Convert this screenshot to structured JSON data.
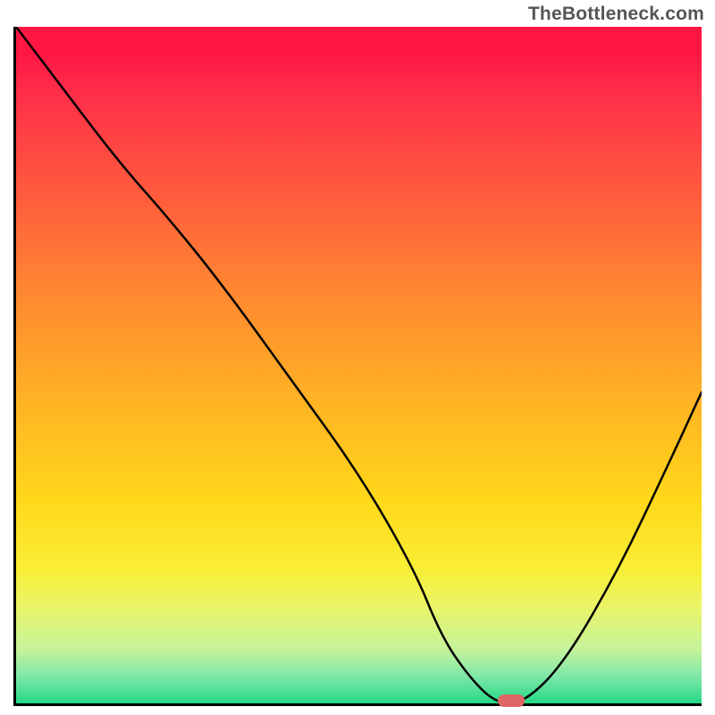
{
  "watermark": "TheBottleneck.com",
  "chart_data": {
    "type": "line",
    "title": "",
    "xlabel": "",
    "ylabel": "",
    "xlim": [
      0,
      100
    ],
    "ylim": [
      0,
      100
    ],
    "grid": false,
    "legend": false,
    "series": [
      {
        "name": "bottleneck-curve",
        "x": [
          0,
          6,
          15,
          22,
          30,
          40,
          50,
          58,
          62,
          66,
          70,
          74,
          80,
          88,
          95,
          100
        ],
        "values": [
          100,
          92,
          80,
          72,
          62,
          48,
          34,
          20,
          10,
          4,
          0,
          0,
          6,
          20,
          35,
          46
        ]
      }
    ],
    "marker": {
      "x": 72,
      "y": 0,
      "color": "#e06666"
    },
    "gradient_stops": [
      {
        "pos": 0,
        "color": "#ff1744"
      },
      {
        "pos": 25,
        "color": "#ff5c3d"
      },
      {
        "pos": 55,
        "color": "#ffb224"
      },
      {
        "pos": 80,
        "color": "#f9ee34"
      },
      {
        "pos": 100,
        "color": "#23d886"
      }
    ]
  }
}
